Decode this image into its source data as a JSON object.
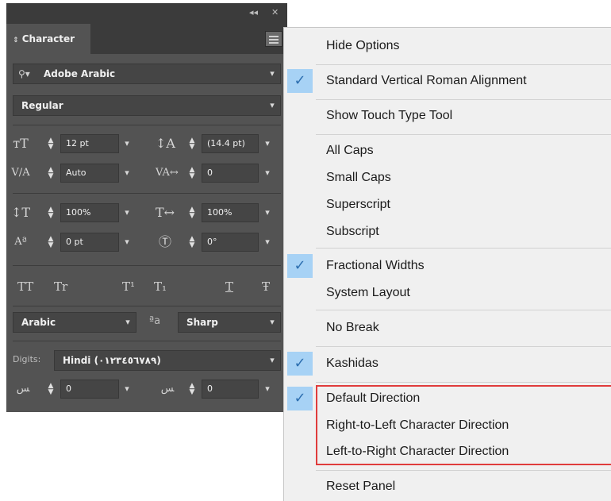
{
  "panel": {
    "tab_label": "Character",
    "font_search": {
      "value": "Adobe Arabic"
    },
    "font_style": "Regular",
    "font_size": "12 pt",
    "leading": "(14.4 pt)",
    "kerning": "Auto",
    "tracking": "0",
    "vertical_scale": "100%",
    "horizontal_scale": "100%",
    "baseline_shift": "0 pt",
    "rotation": "0°",
    "type_styles": [
      "TT",
      "Tr",
      "T¹",
      "T₁",
      "T",
      "Ŧ"
    ],
    "language": "Arabic",
    "antialias_glyph": "ªa",
    "antialias": "Sharp",
    "digits_label": "Digits:",
    "digits_value": "Hindi (٠١٢٣٤٥٦٧٨٩)",
    "kashida_value": "0",
    "diacritic_value": "0"
  },
  "menu": {
    "items": [
      {
        "label": "Hide Options",
        "checked": false
      },
      {
        "label": "Standard Vertical Roman Alignment",
        "checked": true
      },
      {
        "label": "Show Touch Type Tool",
        "checked": false
      },
      {
        "label": "All Caps",
        "checked": false
      },
      {
        "label": "Small Caps",
        "checked": false
      },
      {
        "label": "Superscript",
        "checked": false
      },
      {
        "label": "Subscript",
        "checked": false
      },
      {
        "label": "Fractional Widths",
        "checked": true
      },
      {
        "label": "System Layout",
        "checked": false
      },
      {
        "label": "No Break",
        "checked": false
      },
      {
        "label": "Kashidas",
        "checked": true
      },
      {
        "label": "Default Direction",
        "checked": true
      },
      {
        "label": "Right-to-Left Character Direction",
        "checked": false
      },
      {
        "label": "Left-to-Right Character Direction",
        "checked": false
      },
      {
        "label": "Reset Panel",
        "checked": false
      }
    ]
  },
  "colors": {
    "check_highlight": "#a7d2f5",
    "annotation_outline": "#e03c3c",
    "panel_bg": "#535353"
  }
}
